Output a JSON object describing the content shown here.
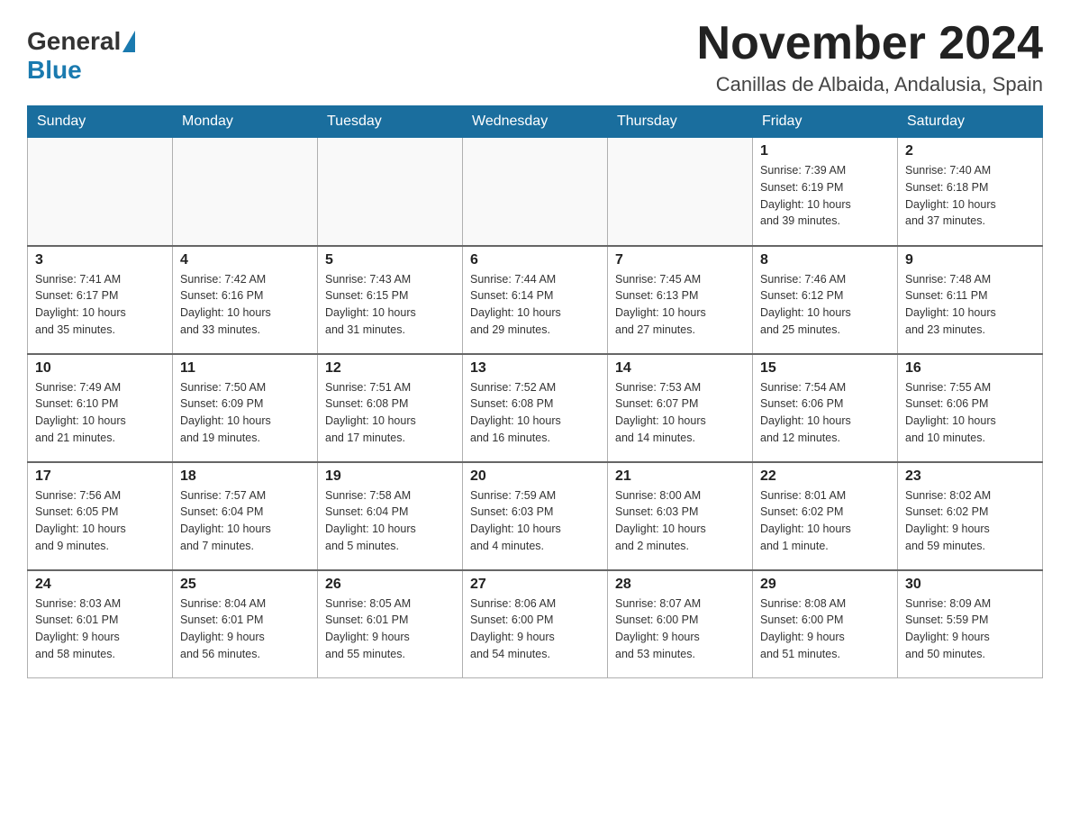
{
  "logo": {
    "general": "General",
    "blue": "Blue"
  },
  "title": "November 2024",
  "subtitle": "Canillas de Albaida, Andalusia, Spain",
  "weekdays": [
    "Sunday",
    "Monday",
    "Tuesday",
    "Wednesday",
    "Thursday",
    "Friday",
    "Saturday"
  ],
  "weeks": [
    [
      {
        "day": "",
        "info": ""
      },
      {
        "day": "",
        "info": ""
      },
      {
        "day": "",
        "info": ""
      },
      {
        "day": "",
        "info": ""
      },
      {
        "day": "",
        "info": ""
      },
      {
        "day": "1",
        "info": "Sunrise: 7:39 AM\nSunset: 6:19 PM\nDaylight: 10 hours\nand 39 minutes."
      },
      {
        "day": "2",
        "info": "Sunrise: 7:40 AM\nSunset: 6:18 PM\nDaylight: 10 hours\nand 37 minutes."
      }
    ],
    [
      {
        "day": "3",
        "info": "Sunrise: 7:41 AM\nSunset: 6:17 PM\nDaylight: 10 hours\nand 35 minutes."
      },
      {
        "day": "4",
        "info": "Sunrise: 7:42 AM\nSunset: 6:16 PM\nDaylight: 10 hours\nand 33 minutes."
      },
      {
        "day": "5",
        "info": "Sunrise: 7:43 AM\nSunset: 6:15 PM\nDaylight: 10 hours\nand 31 minutes."
      },
      {
        "day": "6",
        "info": "Sunrise: 7:44 AM\nSunset: 6:14 PM\nDaylight: 10 hours\nand 29 minutes."
      },
      {
        "day": "7",
        "info": "Sunrise: 7:45 AM\nSunset: 6:13 PM\nDaylight: 10 hours\nand 27 minutes."
      },
      {
        "day": "8",
        "info": "Sunrise: 7:46 AM\nSunset: 6:12 PM\nDaylight: 10 hours\nand 25 minutes."
      },
      {
        "day": "9",
        "info": "Sunrise: 7:48 AM\nSunset: 6:11 PM\nDaylight: 10 hours\nand 23 minutes."
      }
    ],
    [
      {
        "day": "10",
        "info": "Sunrise: 7:49 AM\nSunset: 6:10 PM\nDaylight: 10 hours\nand 21 minutes."
      },
      {
        "day": "11",
        "info": "Sunrise: 7:50 AM\nSunset: 6:09 PM\nDaylight: 10 hours\nand 19 minutes."
      },
      {
        "day": "12",
        "info": "Sunrise: 7:51 AM\nSunset: 6:08 PM\nDaylight: 10 hours\nand 17 minutes."
      },
      {
        "day": "13",
        "info": "Sunrise: 7:52 AM\nSunset: 6:08 PM\nDaylight: 10 hours\nand 16 minutes."
      },
      {
        "day": "14",
        "info": "Sunrise: 7:53 AM\nSunset: 6:07 PM\nDaylight: 10 hours\nand 14 minutes."
      },
      {
        "day": "15",
        "info": "Sunrise: 7:54 AM\nSunset: 6:06 PM\nDaylight: 10 hours\nand 12 minutes."
      },
      {
        "day": "16",
        "info": "Sunrise: 7:55 AM\nSunset: 6:06 PM\nDaylight: 10 hours\nand 10 minutes."
      }
    ],
    [
      {
        "day": "17",
        "info": "Sunrise: 7:56 AM\nSunset: 6:05 PM\nDaylight: 10 hours\nand 9 minutes."
      },
      {
        "day": "18",
        "info": "Sunrise: 7:57 AM\nSunset: 6:04 PM\nDaylight: 10 hours\nand 7 minutes."
      },
      {
        "day": "19",
        "info": "Sunrise: 7:58 AM\nSunset: 6:04 PM\nDaylight: 10 hours\nand 5 minutes."
      },
      {
        "day": "20",
        "info": "Sunrise: 7:59 AM\nSunset: 6:03 PM\nDaylight: 10 hours\nand 4 minutes."
      },
      {
        "day": "21",
        "info": "Sunrise: 8:00 AM\nSunset: 6:03 PM\nDaylight: 10 hours\nand 2 minutes."
      },
      {
        "day": "22",
        "info": "Sunrise: 8:01 AM\nSunset: 6:02 PM\nDaylight: 10 hours\nand 1 minute."
      },
      {
        "day": "23",
        "info": "Sunrise: 8:02 AM\nSunset: 6:02 PM\nDaylight: 9 hours\nand 59 minutes."
      }
    ],
    [
      {
        "day": "24",
        "info": "Sunrise: 8:03 AM\nSunset: 6:01 PM\nDaylight: 9 hours\nand 58 minutes."
      },
      {
        "day": "25",
        "info": "Sunrise: 8:04 AM\nSunset: 6:01 PM\nDaylight: 9 hours\nand 56 minutes."
      },
      {
        "day": "26",
        "info": "Sunrise: 8:05 AM\nSunset: 6:01 PM\nDaylight: 9 hours\nand 55 minutes."
      },
      {
        "day": "27",
        "info": "Sunrise: 8:06 AM\nSunset: 6:00 PM\nDaylight: 9 hours\nand 54 minutes."
      },
      {
        "day": "28",
        "info": "Sunrise: 8:07 AM\nSunset: 6:00 PM\nDaylight: 9 hours\nand 53 minutes."
      },
      {
        "day": "29",
        "info": "Sunrise: 8:08 AM\nSunset: 6:00 PM\nDaylight: 9 hours\nand 51 minutes."
      },
      {
        "day": "30",
        "info": "Sunrise: 8:09 AM\nSunset: 5:59 PM\nDaylight: 9 hours\nand 50 minutes."
      }
    ]
  ]
}
